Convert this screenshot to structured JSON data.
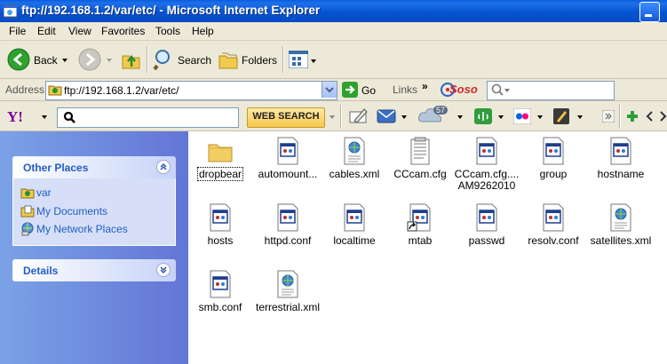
{
  "window": {
    "title": "ftp://192.168.1.2/var/etc/ - Microsoft Internet Explorer"
  },
  "menu": [
    "File",
    "Edit",
    "View",
    "Favorites",
    "Tools",
    "Help"
  ],
  "toolbar": {
    "back": "Back",
    "search": "Search",
    "folders": "Folders"
  },
  "address": {
    "label": "Address",
    "value": "ftp://192.168.1.2/var/etc/",
    "go": "Go",
    "links": "Links",
    "soso_logo": "Soso"
  },
  "yahoo": {
    "logo": "Y!",
    "button": "WEB SEARCH",
    "weather_badge": "57"
  },
  "sidebar": {
    "other_places": {
      "title": "Other Places",
      "items": [
        {
          "label": "var",
          "icon": "ftp-folder-icon"
        },
        {
          "label": "My Documents",
          "icon": "my-documents-icon"
        },
        {
          "label": "My Network Places",
          "icon": "network-places-icon"
        }
      ]
    },
    "details": {
      "title": "Details"
    }
  },
  "files": [
    {
      "name": "dropbear",
      "type": "folder",
      "selected": true
    },
    {
      "name": "automount...",
      "type": "doc"
    },
    {
      "name": "cables.xml",
      "type": "xml"
    },
    {
      "name": "CCcam.cfg",
      "type": "text"
    },
    {
      "name": "CCcam.cfg.... AM9262010",
      "type": "doc"
    },
    {
      "name": "group",
      "type": "doc"
    },
    {
      "name": "hostname",
      "type": "doc"
    },
    {
      "name": "hosts",
      "type": "doc"
    },
    {
      "name": "httpd.conf",
      "type": "doc"
    },
    {
      "name": "localtime",
      "type": "doc"
    },
    {
      "name": "mtab",
      "type": "shortcut"
    },
    {
      "name": "passwd",
      "type": "doc"
    },
    {
      "name": "resolv.conf",
      "type": "doc"
    },
    {
      "name": "satellites.xml",
      "type": "xml"
    },
    {
      "name": "smb.conf",
      "type": "doc"
    },
    {
      "name": "terrestrial.xml",
      "type": "xml"
    }
  ]
}
